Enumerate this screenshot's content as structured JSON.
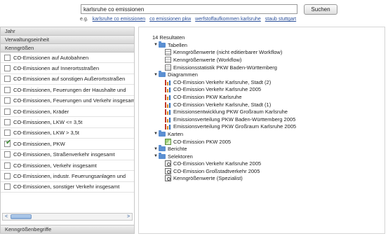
{
  "search": {
    "value": "karlsruhe co emissionen",
    "button_label": "Suchen",
    "suggestions_prefix": "e.g.",
    "suggestions": [
      "karlsruhe co emissionen",
      "co emissionen pkw",
      "werfstoffaufkommen karlsruhe",
      "staub stuttgart"
    ]
  },
  "left_panel": {
    "sections": [
      "Jahr",
      "Verwaltungseinheit",
      "Kenngrößen"
    ],
    "items": [
      {
        "label": "CO-Emissionen auf Autobahnen",
        "checked": false
      },
      {
        "label": "CO-Emissionen auf Innerortsstraßen",
        "checked": false
      },
      {
        "label": "CO-Emissionen auf sonstigen Außerortsstraßen",
        "checked": false
      },
      {
        "label": "CO-Emissionen, Feuerungen der Haushalte und",
        "checked": false
      },
      {
        "label": "CO-Emissionen, Feuerungen und Verkehr insgesamt",
        "checked": false
      },
      {
        "label": "CO-Emissionen, Kräder",
        "checked": false
      },
      {
        "label": "CO-Emissionen, LKW <= 3,5t",
        "checked": false
      },
      {
        "label": "CO-Emissionen, LKW > 3,5t",
        "checked": false
      },
      {
        "label": "CO-Emissionen, PKW",
        "checked": true
      },
      {
        "label": "CO-Emissionen, Straßenverkehr insgesamt",
        "checked": false
      },
      {
        "label": "CO-Emissionen, Verkehr insgesamt",
        "checked": false
      },
      {
        "label": "CO-Emissionen, industr. Feuerungsanlagen und",
        "checked": false
      },
      {
        "label": "CO-Emissionen, sonstiger Verkehr insgesamt",
        "checked": false
      }
    ],
    "scroll_left": "<",
    "scroll_right": ">",
    "footer": "Kenngrößenbegriffe"
  },
  "results": {
    "count_label": "14 Resultaten",
    "groups": [
      {
        "label": "Tabellen",
        "icon": "table-icon",
        "items": [
          "Kenngrößenwerte (nicht editierbarer Workflow)",
          "Kenngrößenwerte (Workflow)",
          "Emissionsstatistik PKW Baden-Württemberg"
        ]
      },
      {
        "label": "Diagrammen",
        "icon": "bar-chart-icon",
        "items": [
          "CO-Emission Verkehr Karlsruhe, Stadt (2)",
          "CO-Emission Verkehr Karlsruhe 2005",
          "CO-Emission PKW Karlsruhe",
          "CO-Emission Verkehr Karlsruhe, Stadt (1)",
          "Emissionsentwicklung PKW Großraum Karlsruhe",
          "Emissionsverteilung PKW Baden-Württemberg 2005",
          "Emissionsverteilung PKW Großraum Karlsruhe 2005"
        ]
      },
      {
        "label": "Karten",
        "icon": "map-icon",
        "items": [
          "CO-Emission PKW 2005"
        ]
      },
      {
        "label": "Berichte",
        "icon": "report-icon",
        "items": []
      },
      {
        "label": "Selektoren",
        "icon": "selector-icon",
        "items": [
          "CO-Emission Verkehr Karlsruhe 2005",
          "CO-Emission Großstadtverkehr 2005",
          "Kenngrößenwerte (Spezialist)"
        ]
      }
    ]
  },
  "colors": {
    "folder": "#5b8fd1",
    "link": "#2a4f9a",
    "checkmark": "#3a8a2e"
  }
}
